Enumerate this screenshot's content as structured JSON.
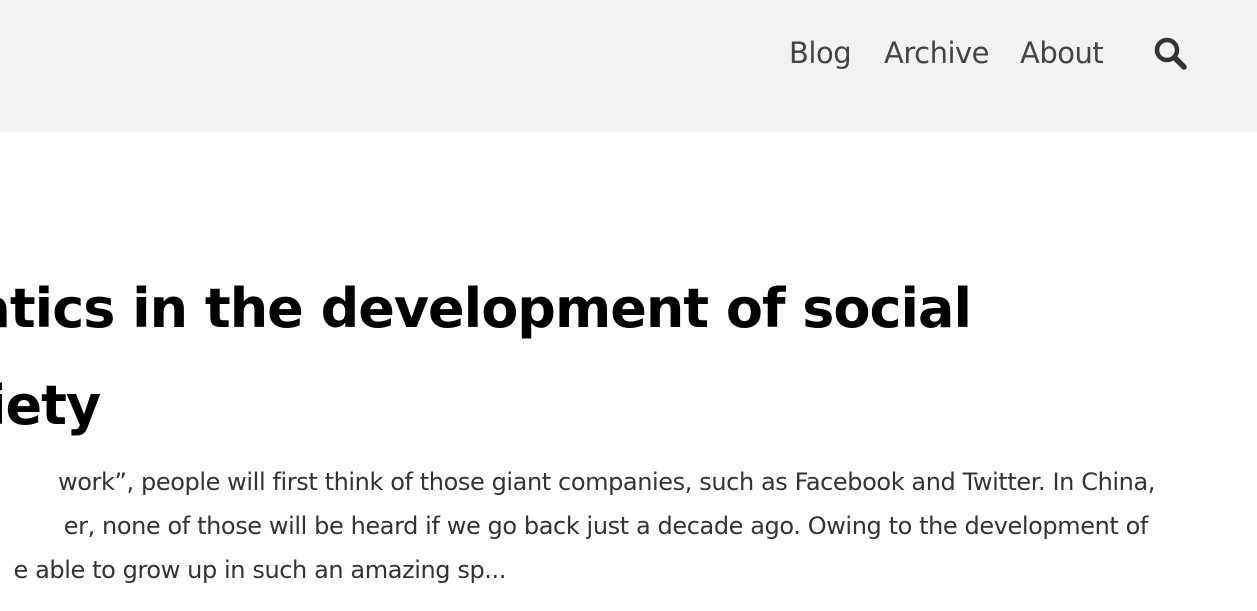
{
  "header": {
    "nav": {
      "blog_label": "Blog",
      "archive_label": "Archive",
      "about_label": "About",
      "search_icon": "search-icon"
    },
    "background_color": "#f2f2f2"
  },
  "post": {
    "title_lines": [
      "natics in the development of social",
      "ir impact on society"
    ],
    "excerpt_lines": [
      "work”, people will first think of those giant companies, such as Facebook and Twitter. In China,",
      "er, none of those will be heard if we go back just a decade ago. Owing to the development of",
      "e able to grow up in such an amazing sp..."
    ]
  }
}
